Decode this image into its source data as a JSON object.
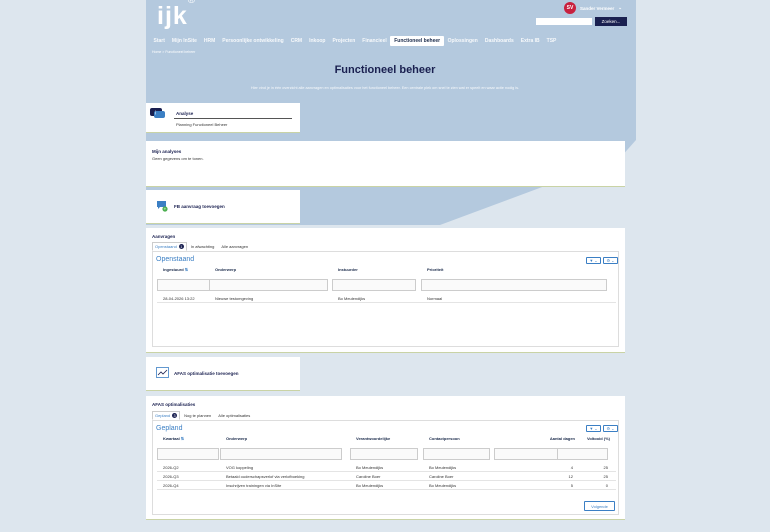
{
  "brand": {
    "logo": "ijk",
    "logo_mark": "®"
  },
  "user": {
    "initials": "SV",
    "name": "Sander Vermeer"
  },
  "search": {
    "placeholder": "",
    "button": "Zoeken..."
  },
  "nav": [
    "Start",
    "Mijn InSite",
    "HRM",
    "Persoonlijke ontwikkeling",
    "CRM",
    "Inkoop",
    "Projecten",
    "Financieel",
    "Functioneel beheer",
    "Oplossingen",
    "Dashboards",
    "Extra IB",
    "TSP"
  ],
  "nav_active": "Functioneel beheer",
  "breadcrumb": "Home  >  Functioneel beheer",
  "page": {
    "title": "Functioneel beheer",
    "subtitle": "Hier vind je in één overzicht alle aanvragen en optimalisaties voor het functioneel beheer. Een centrale plek om snel te zien wat er speelt en waar actie nodig is."
  },
  "analyse": {
    "title": "Analyse",
    "link": "Planning Functioneel Beheer"
  },
  "mijn_analyses": {
    "title": "Mijn analyses",
    "empty": "Geen gegevens om te tonen."
  },
  "fb_add": {
    "label": "FB aanvraag toevoegen"
  },
  "aanvragen": {
    "section_title": "Aanvragen",
    "tabs": [
      {
        "label": "Openstaand",
        "badge": "1"
      },
      {
        "label": "In afwachting",
        "badge": ""
      },
      {
        "label": "Alle aanvragen",
        "badge": ""
      }
    ],
    "view_title": "Openstaand",
    "columns": [
      "Ingestuurd",
      "Onderwerp",
      "Instuurder",
      "Prioriteit"
    ],
    "rows": [
      [
        "28-04-2026 13:22",
        "Nieuwe testomgeving",
        "Bo Meulendijks",
        "Normaal"
      ]
    ]
  },
  "afas_add": {
    "label": "AFAS optimalisatie toevoegen"
  },
  "optimalisaties": {
    "section_title": "AFAS optimalisaties",
    "tabs": [
      {
        "label": "Gepland",
        "badge": "3"
      },
      {
        "label": "Nog te plannen",
        "badge": ""
      },
      {
        "label": "Alle optimalisaties",
        "badge": ""
      }
    ],
    "view_title": "Gepland",
    "columns": [
      "Kwartaal",
      "Onderwerp",
      "Verantwoordelijke",
      "Contactpersoon",
      "Aantal dagen",
      "Voltooid (%)"
    ],
    "rows": [
      [
        "2026-Q2",
        "VOG koppeling",
        "Bo Meulendijks",
        "Bo Meulendijks",
        "4",
        "25"
      ],
      [
        "2026-Q3",
        "Betaald ouderschapsverlof via verlofboeking",
        "Caroline Boer",
        "Caroline Boer",
        "12",
        "25"
      ],
      [
        "2026-Q4",
        "Inschrijven trainingen via InSite",
        "Bo Meulendijks",
        "Bo Meulendijks",
        "5",
        "0"
      ]
    ],
    "next_button": "Volgende"
  },
  "colors": {
    "header_bg": "#b9cde0",
    "accent": "#3b7fc4",
    "navy": "#1a2050",
    "avatar": "#c8203e"
  }
}
